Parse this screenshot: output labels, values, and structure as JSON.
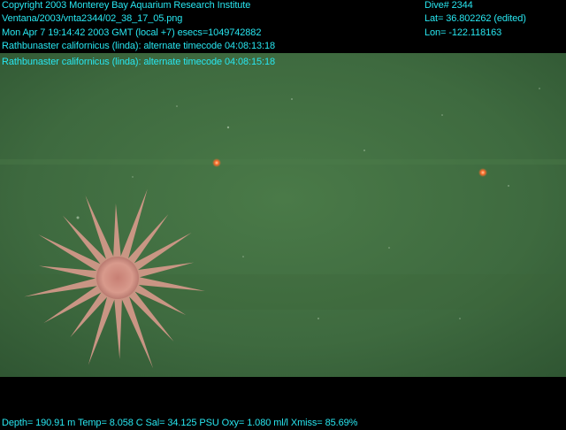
{
  "header": {
    "copyright": "Copyright 2003 Monterey Bay Aquarium Research Institute",
    "filename": "Ventana/2003/vnta2344/02_38_17_05.png",
    "datetime": "Mon Apr  7 19:14:42 2003 GMT (local +7)  esecs=1049742882",
    "annotation_1": "Rathbunaster californicus (linda): alternate timecode 04:08:13:18",
    "annotation_2": "Rathbunaster californicus (linda): alternate timecode 04:08:15:18"
  },
  "navigation": {
    "dive": "Dive# 2344",
    "lat": "Lat= 36.802262 (edited)",
    "lon": "Lon= -122.118163"
  },
  "footer": {
    "sensors": "Depth= 190.91 m  Temp= 8.058 C  Sal= 34.125 PSU  Oxy= 1.080 ml/l  Xmiss= 85.69%"
  },
  "colors": {
    "overlay_text": "#28e6f0",
    "seafloor": "#3e6a3f",
    "sea_star": "#d89a8c",
    "laser_dot": "#ff6a2a"
  }
}
